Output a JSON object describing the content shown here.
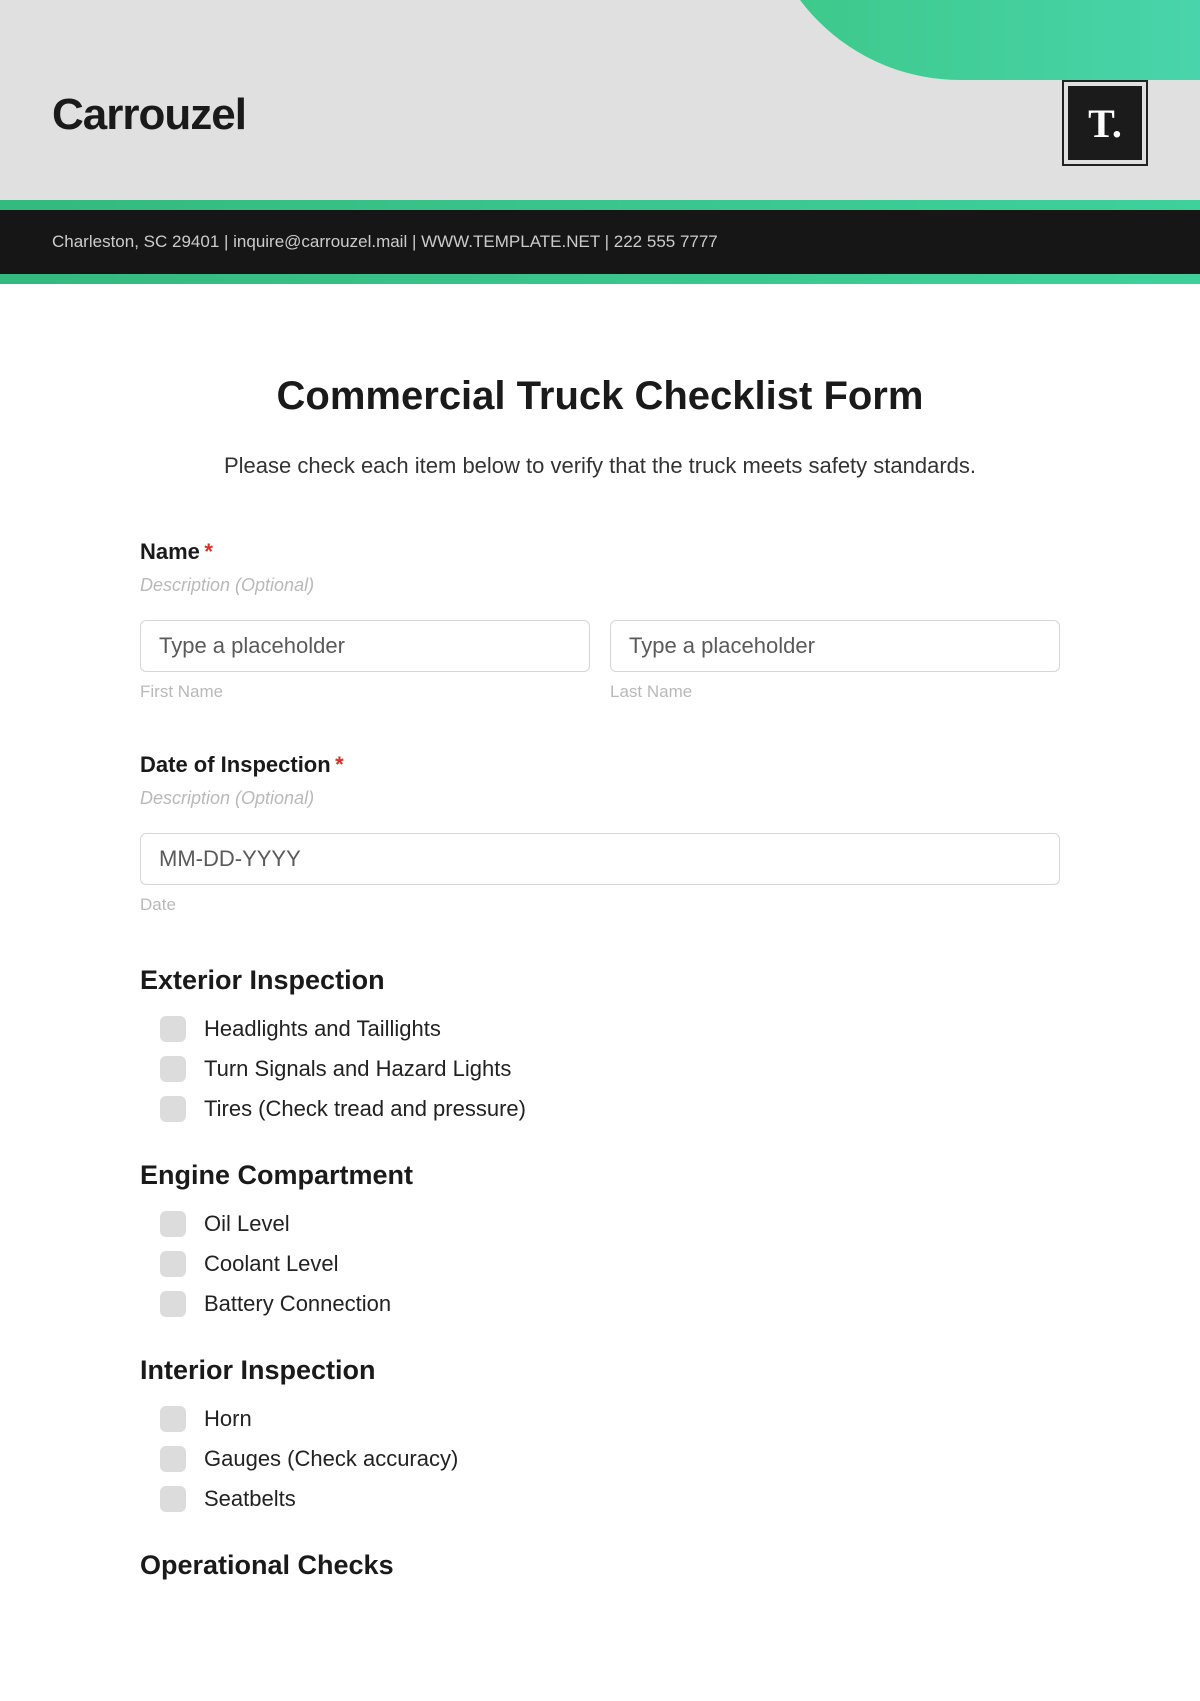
{
  "header": {
    "brand": "Carrouzel",
    "logo_text": "T.",
    "contact_line": "Charleston, SC 29401 | inquire@carrouzel.mail | WWW.TEMPLATE.NET | 222 555 7777"
  },
  "form": {
    "title": "Commercial Truck Checklist Form",
    "description": "Please check each item below to verify that the truck meets safety standards.",
    "name_field": {
      "label": "Name",
      "required_mark": "*",
      "description": "Description (Optional)",
      "first_placeholder": "Type a placeholder",
      "first_sublabel": "First Name",
      "last_placeholder": "Type a placeholder",
      "last_sublabel": "Last Name"
    },
    "date_field": {
      "label": "Date of Inspection",
      "required_mark": "*",
      "description": "Description (Optional)",
      "placeholder": "MM-DD-YYYY",
      "sublabel": "Date"
    },
    "sections": {
      "exterior": {
        "title": "Exterior Inspection",
        "items": [
          "Headlights and Taillights",
          "Turn Signals and Hazard Lights",
          "Tires (Check tread and pressure)"
        ]
      },
      "engine": {
        "title": "Engine Compartment",
        "items": [
          "Oil Level",
          "Coolant Level",
          "Battery Connection"
        ]
      },
      "interior": {
        "title": "Interior Inspection",
        "items": [
          "Horn",
          "Gauges (Check accuracy)",
          "Seatbelts"
        ]
      },
      "operational": {
        "title": "Operational Checks"
      }
    }
  }
}
